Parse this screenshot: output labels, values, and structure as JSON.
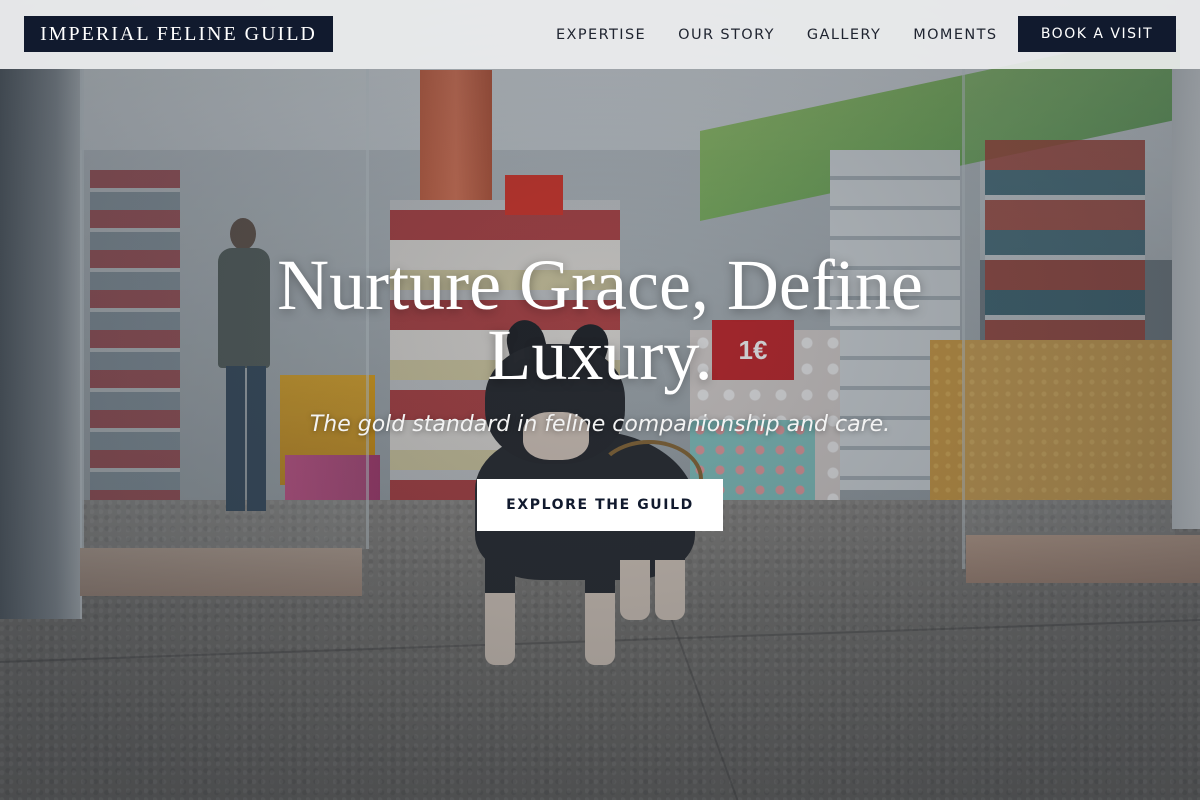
{
  "nav": {
    "brand": "IMPERIAL FELINE GUILD",
    "links": [
      "EXPERTISE",
      "OUR STORY",
      "GALLERY",
      "MOMENTS"
    ],
    "book_button": "BOOK A VISIT"
  },
  "hero": {
    "title": "Nurture Grace, Define Luxury.",
    "subtitle": "The gold standard in feline companionship and care.",
    "cta_button": "EXPLORE THE GUILD",
    "scene_sign": "1€"
  },
  "colors": {
    "navy": "#111a2e",
    "white": "#ffffff",
    "nav_background": "#eeeff1"
  }
}
